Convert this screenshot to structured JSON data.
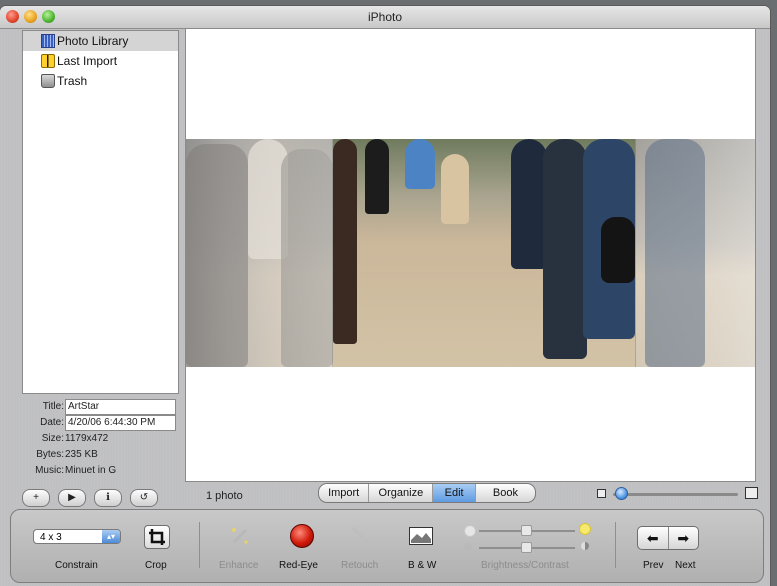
{
  "window": {
    "title": "iPhoto"
  },
  "sources": [
    {
      "label": "Photo Library",
      "icon": "photo-library-icon"
    },
    {
      "label": "Last Import",
      "icon": "film-roll-icon"
    },
    {
      "label": "Trash",
      "icon": "trash-icon"
    }
  ],
  "info": {
    "title_label": "Title:",
    "title_value": "ArtStar",
    "date_label": "Date:",
    "date_value": "4/20/06  6:44:30 PM",
    "size_label": "Size:",
    "size_value": "1179x472",
    "bytes_label": "Bytes:",
    "bytes_value": "235 KB",
    "music_label": "Music:",
    "music_value": "Minuet in G"
  },
  "side_buttons": {
    "add": "+",
    "play": "▶",
    "info": "ℹ",
    "rotate": "↺"
  },
  "status": {
    "count": "1 photo"
  },
  "modes": [
    {
      "label": "Import",
      "active": false
    },
    {
      "label": "Organize",
      "active": false
    },
    {
      "label": "Edit",
      "active": true
    },
    {
      "label": "Book",
      "active": false
    }
  ],
  "edit_toolbar": {
    "constrain_value": "4 x 3",
    "constrain_label": "Constrain",
    "crop_label": "Crop",
    "enhance_label": "Enhance",
    "redeye_label": "Red-Eye",
    "retouch_label": "Retouch",
    "bw_label": "B & W",
    "bc_label": "Brightness/Contrast",
    "prev_label": "Prev",
    "next_label": "Next",
    "prev_arrow": "⬅",
    "next_arrow": "➡"
  },
  "colors": {
    "accent": "#5f9be2",
    "window_bg": "#c0c1c3"
  }
}
